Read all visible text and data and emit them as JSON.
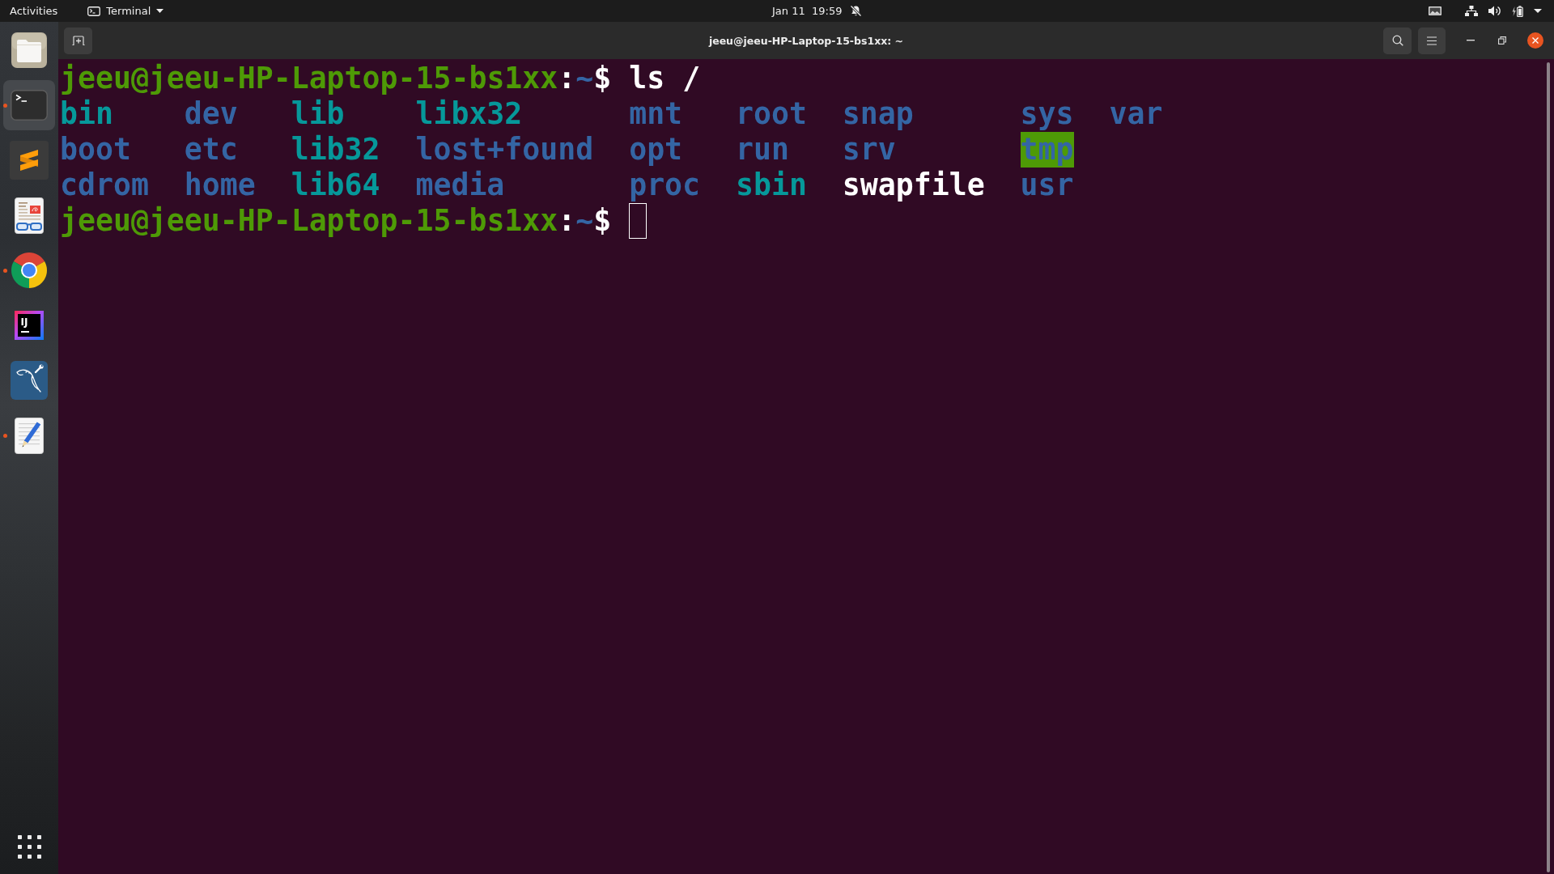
{
  "top_bar": {
    "activities": "Activities",
    "app_menu": "Terminal",
    "clock": "Jan 11  19:59",
    "do_not_disturb": true
  },
  "dock": {
    "items": [
      {
        "selected": false,
        "running": false
      },
      {
        "selected": true,
        "running": true
      },
      {
        "selected": false,
        "running": false
      },
      {
        "selected": false,
        "running": false
      },
      {
        "selected": false,
        "running": true
      },
      {
        "selected": false,
        "running": false,
        "logo_text": "IJ"
      },
      {
        "selected": false,
        "running": false
      },
      {
        "selected": false,
        "running": true
      }
    ]
  },
  "terminal": {
    "title": "jeeu@jeeu-HP-Laptop-15-bs1xx: ~",
    "lines": [
      {
        "kind": "prompt",
        "user_host": "jeeu@jeeu-HP-Laptop-15-bs1xx",
        "separator": ":",
        "path": "~",
        "symbol": "$",
        "command": "ls /",
        "cursor": false
      },
      {
        "kind": "listing",
        "entries": [
          {
            "name": "bin",
            "kind": "link"
          },
          {
            "name": "dev",
            "kind": "directory"
          },
          {
            "name": "lib",
            "kind": "link"
          },
          {
            "name": "libx32",
            "kind": "link"
          },
          {
            "name": "mnt",
            "kind": "directory"
          },
          {
            "name": "root",
            "kind": "directory"
          },
          {
            "name": "snap",
            "kind": "directory"
          },
          {
            "name": "sys",
            "kind": "directory"
          },
          {
            "name": "var",
            "kind": "directory"
          }
        ]
      },
      {
        "kind": "listing",
        "entries": [
          {
            "name": "boot",
            "kind": "directory"
          },
          {
            "name": "etc",
            "kind": "directory"
          },
          {
            "name": "lib32",
            "kind": "link"
          },
          {
            "name": "lost+found",
            "kind": "directory"
          },
          {
            "name": "opt",
            "kind": "directory"
          },
          {
            "name": "run",
            "kind": "directory"
          },
          {
            "name": "srv",
            "kind": "directory"
          },
          {
            "name": "tmp",
            "kind": "sticky"
          }
        ]
      },
      {
        "kind": "listing",
        "entries": [
          {
            "name": "cdrom",
            "kind": "directory"
          },
          {
            "name": "home",
            "kind": "directory"
          },
          {
            "name": "lib64",
            "kind": "link"
          },
          {
            "name": "media",
            "kind": "directory"
          },
          {
            "name": "proc",
            "kind": "directory"
          },
          {
            "name": "sbin",
            "kind": "link"
          },
          {
            "name": "swapfile",
            "kind": "file"
          },
          {
            "name": "usr",
            "kind": "directory"
          }
        ]
      },
      {
        "kind": "prompt",
        "user_host": "jeeu@jeeu-HP-Laptop-15-bs1xx",
        "separator": ":",
        "path": "~",
        "symbol": "$",
        "cursor": true
      }
    ]
  }
}
